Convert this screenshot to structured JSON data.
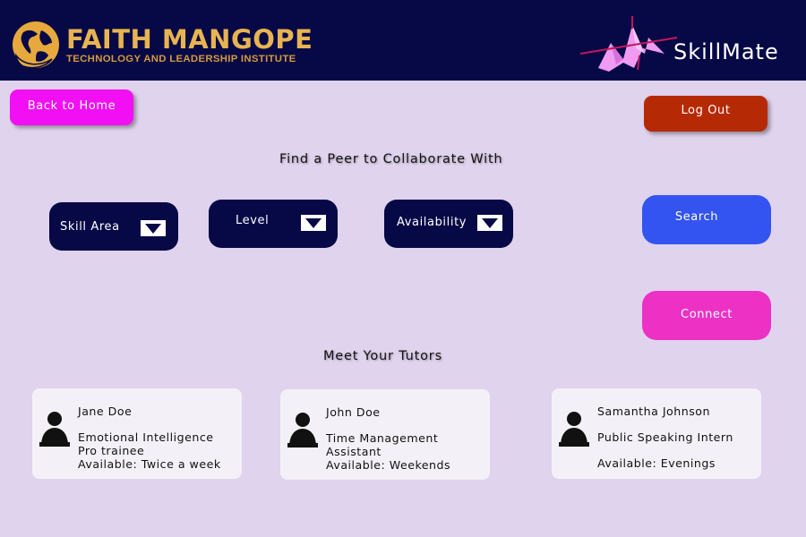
{
  "header": {
    "brand_name": "FAITH MANGOPE",
    "brand_subtitle": "TECHNOLOGY AND LEADERSHIP INSTITUTE",
    "app_name": "SkillMate",
    "background_color": "#070846",
    "brand_color": "#e7b451"
  },
  "nav": {
    "back_label": "Back to Home",
    "logout_label": "Log Out"
  },
  "search": {
    "heading": "Find a Peer to Collaborate With",
    "filters": [
      {
        "label": "Skill Area",
        "icon": "chevron-down-icon"
      },
      {
        "label": "Level",
        "icon": "chevron-down-icon"
      },
      {
        "label": "Availability",
        "icon": "chevron-down-icon"
      }
    ],
    "search_label": "Search",
    "connect_label": "Connect"
  },
  "tutors": {
    "heading": "Meet Your Tutors",
    "items": [
      {
        "name": "Jane Doe",
        "role_lines": [
          "Emotional Intelligence",
          "Pro trainee"
        ],
        "availability": "Available: Twice a week",
        "avatar_icon": "user-avatar-icon"
      },
      {
        "name": "John Doe",
        "role_lines": [
          "Time Management",
          "Assistant"
        ],
        "availability": "Available: Weekends",
        "avatar_icon": "user-avatar-icon"
      },
      {
        "name": "Samantha Johnson",
        "role_lines": [
          "Public Speaking Intern"
        ],
        "availability": "Available: Evenings",
        "avatar_icon": "user-avatar-icon"
      }
    ]
  },
  "colors": {
    "page_background": "#e0d3ee",
    "back_button": "#f20ff3",
    "logout_button": "#b52a05",
    "search_button": "#3354f0",
    "connect_button": "#ec31c4",
    "dropdown": "#070846"
  }
}
